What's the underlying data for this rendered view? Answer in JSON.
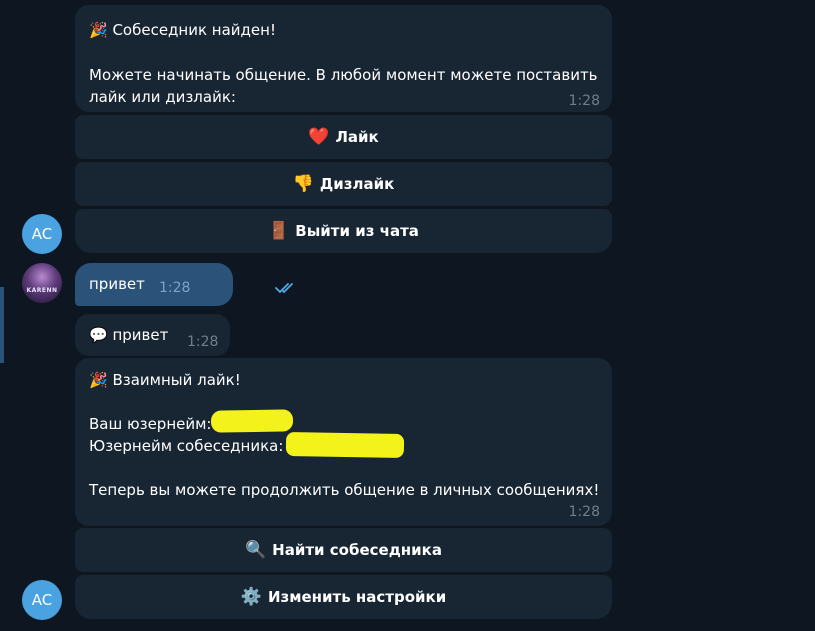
{
  "messages": {
    "found": {
      "title": "🎉 Собеседник найден!",
      "body_line1": "Можете начинать общение. В любой момент можете поставить",
      "body_line2": "лайк или дизлайк:",
      "time": "1:28"
    },
    "outgoing": {
      "text": "привет",
      "time": "1:28",
      "status_icon": "double-check-icon"
    },
    "incoming_echo": {
      "text": "💬 привет",
      "time": "1:28"
    },
    "mutual": {
      "title": "🎉 Взаимный лайк!",
      "your_username_label": "Ваш юзернейм:",
      "partner_username_label": "Юзернейм собеседника:",
      "footer": "Теперь вы можете продолжить общение в личных сообщениях!",
      "time": "1:28"
    }
  },
  "buttons": {
    "like": {
      "emoji": "❤️",
      "label": "Лайк"
    },
    "dislike": {
      "emoji": "👎",
      "label": "Дизлайк"
    },
    "leave": {
      "emoji": "🚪",
      "label": "Выйти из чата"
    },
    "find": {
      "emoji": "🔍",
      "label": "Найти собеседника"
    },
    "settings": {
      "emoji": "⚙️",
      "label": "Изменить настройки"
    }
  },
  "avatars": {
    "bot_initials": "AC",
    "user_label": "KARENN"
  },
  "colors": {
    "background": "#0e1621",
    "bubble": "#182533",
    "outgoing_bubble": "#2b5278",
    "avatar_bot": "#4aa3e0",
    "highlight": "#f3f21a",
    "time_text": "#6d7f8f"
  }
}
